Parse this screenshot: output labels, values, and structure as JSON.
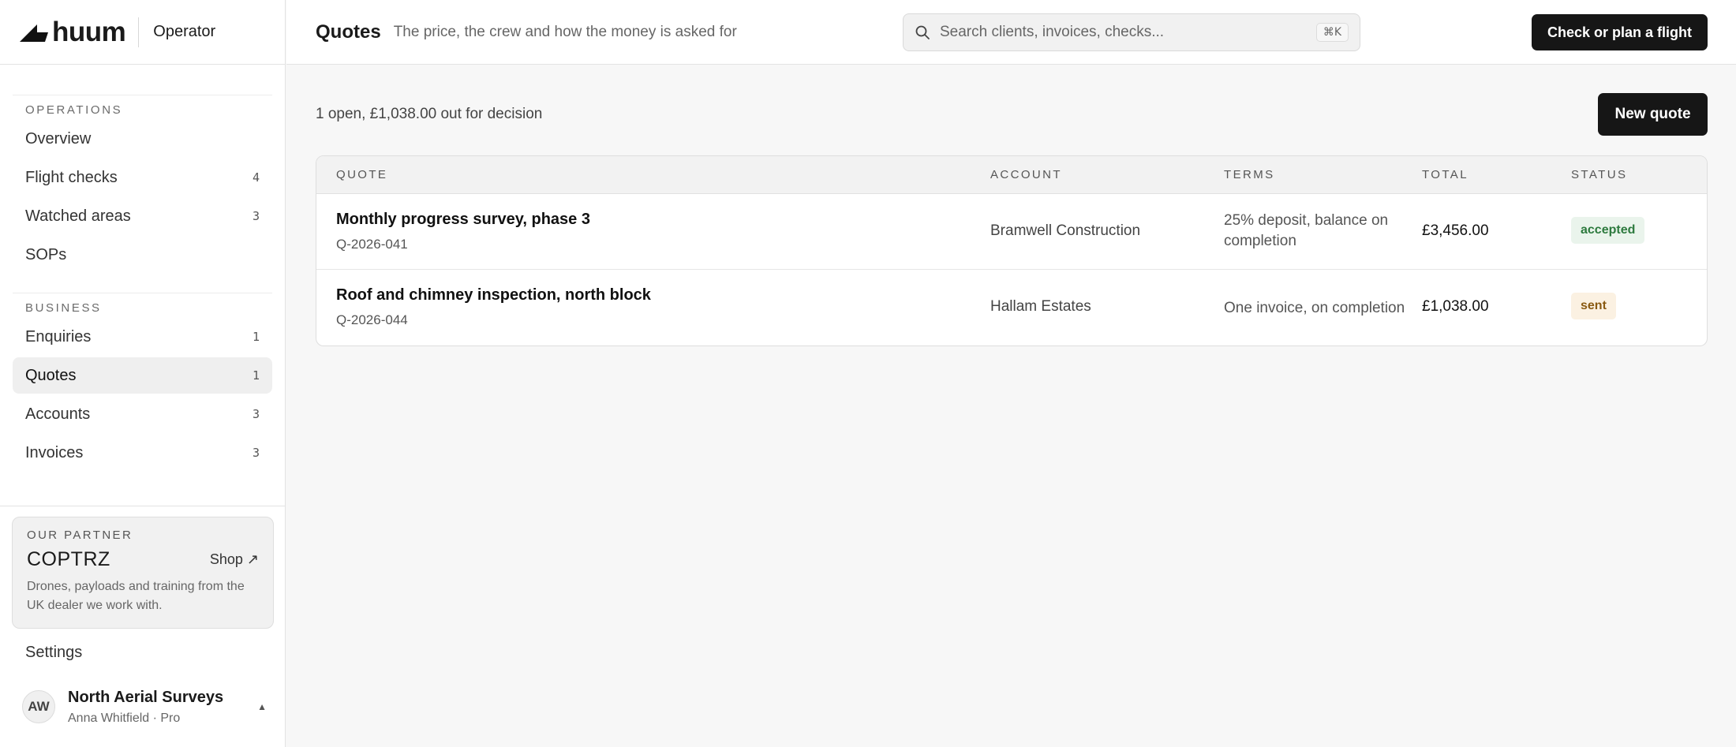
{
  "brand": {
    "logo_text": "huum",
    "product": "Operator"
  },
  "sidebar": {
    "sections": [
      {
        "label": "OPERATIONS",
        "items": [
          {
            "label": "Overview",
            "count": ""
          },
          {
            "label": "Flight checks",
            "count": "4"
          },
          {
            "label": "Watched areas",
            "count": "3"
          },
          {
            "label": "SOPs",
            "count": ""
          }
        ]
      },
      {
        "label": "BUSINESS",
        "items": [
          {
            "label": "Enquiries",
            "count": "1"
          },
          {
            "label": "Quotes",
            "count": "1",
            "active": true
          },
          {
            "label": "Accounts",
            "count": "3"
          },
          {
            "label": "Invoices",
            "count": "3"
          }
        ]
      }
    ],
    "partner": {
      "label": "OUR PARTNER",
      "name": "COPTRZ",
      "shop_label": "Shop ↗",
      "description": "Drones, payloads and training from the UK dealer we work with."
    },
    "settings_label": "Settings",
    "account": {
      "initials": "AW",
      "name": "North Aerial Surveys",
      "subtitle": "Anna Whitfield · Pro",
      "caret": "▲"
    }
  },
  "header": {
    "title": "Quotes",
    "subtitle": "The price, the crew and how the money is asked for",
    "search_placeholder": "Search clients, invoices, checks...",
    "search_shortcut": "⌘K",
    "cta_label": "Check or plan a flight"
  },
  "main": {
    "summary": "1 open, £1,038.00 out for decision",
    "new_quote_label": "New quote",
    "columns": [
      "QUOTE",
      "ACCOUNT",
      "TERMS",
      "TOTAL",
      "STATUS"
    ],
    "rows": [
      {
        "title": "Monthly progress survey, phase 3",
        "id": "Q-2026-041",
        "account": "Bramwell Construction",
        "terms": "25% deposit, balance on completion",
        "total": "£3,456.00",
        "status": "accepted"
      },
      {
        "title": "Roof and chimney inspection, north block",
        "id": "Q-2026-044",
        "account": "Hallam Estates",
        "terms": "One invoice, on completion",
        "total": "£1,038.00",
        "status": "sent"
      }
    ]
  },
  "colors": {
    "accent_dark": "#161616",
    "accepted": "#2d7a3e",
    "sent": "#8a5a12"
  }
}
